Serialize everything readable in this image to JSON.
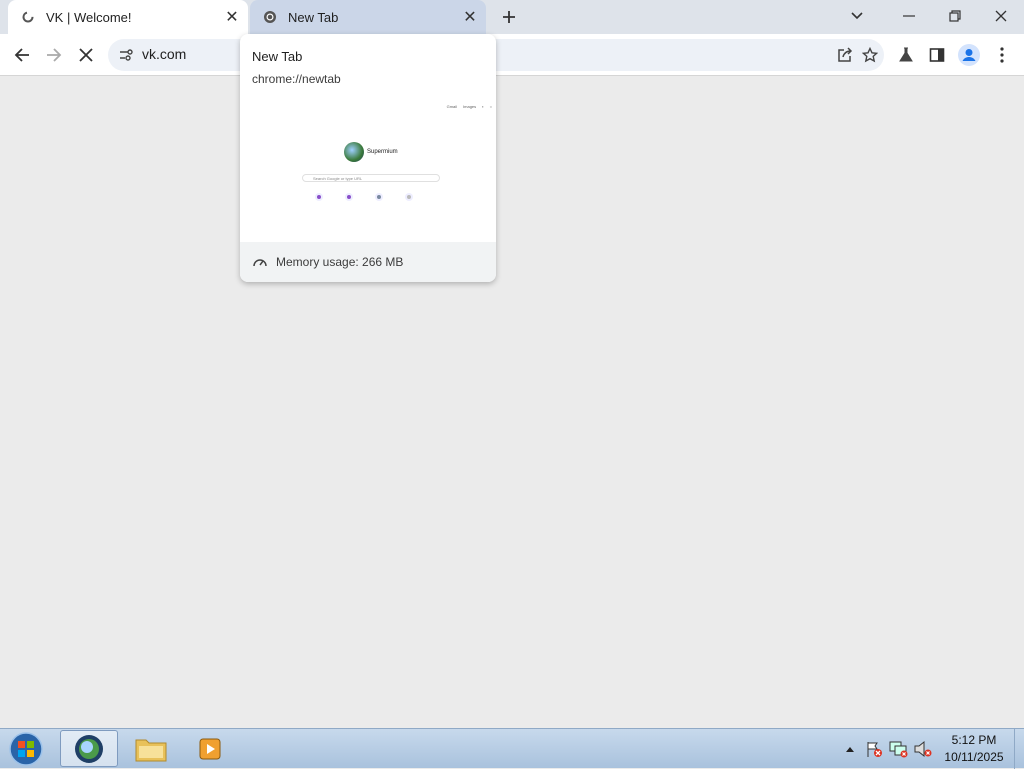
{
  "tabs": [
    {
      "title": "VK | Welcome!",
      "favicon": "vk-loading-icon",
      "active": true
    },
    {
      "title": "New Tab",
      "favicon": "chromium-icon",
      "active": false
    }
  ],
  "toolbar": {
    "url": "vk.com"
  },
  "hover_card": {
    "title": "New Tab",
    "url": "chrome://newtab",
    "memory": "Memory usage: 266 MB",
    "preview": {
      "brand": "Supermium",
      "search_placeholder": "Search Google or type URL",
      "top_links": [
        "Gmail",
        "Images"
      ],
      "shortcuts": [
        "",
        "",
        "",
        ""
      ]
    }
  },
  "taskbar": {
    "time": "5:12 PM",
    "date": "10/11/2025"
  },
  "colors": {
    "tabstrip_bg": "#dee3ea",
    "content_bg": "#ebebeb",
    "accent": "#1a73e8"
  }
}
